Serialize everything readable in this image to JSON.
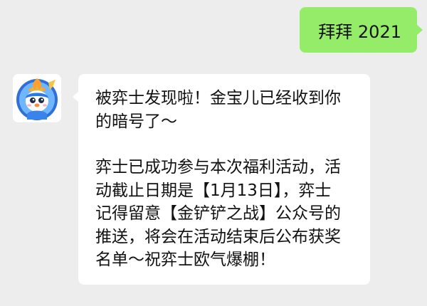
{
  "outgoing_message": {
    "text": "拜拜 2021",
    "bubble_color": "#95ec69"
  },
  "incoming_message": {
    "avatar_icon": "penguin-mascot-avatar-icon",
    "bubble_color": "#ffffff",
    "paragraphs": [
      "被弈士发现啦！金宝儿已经收到你\n的暗号了～",
      "弈士已成功参与本次福利活动，活\n动截止日期是【1月13日】，弈士\n记得留意【金铲铲之战】公众号的\n推送，将会在活动结束后公布获奖\n名单～祝弈士欧气爆棚！"
    ]
  },
  "chat_background": "#ededed"
}
